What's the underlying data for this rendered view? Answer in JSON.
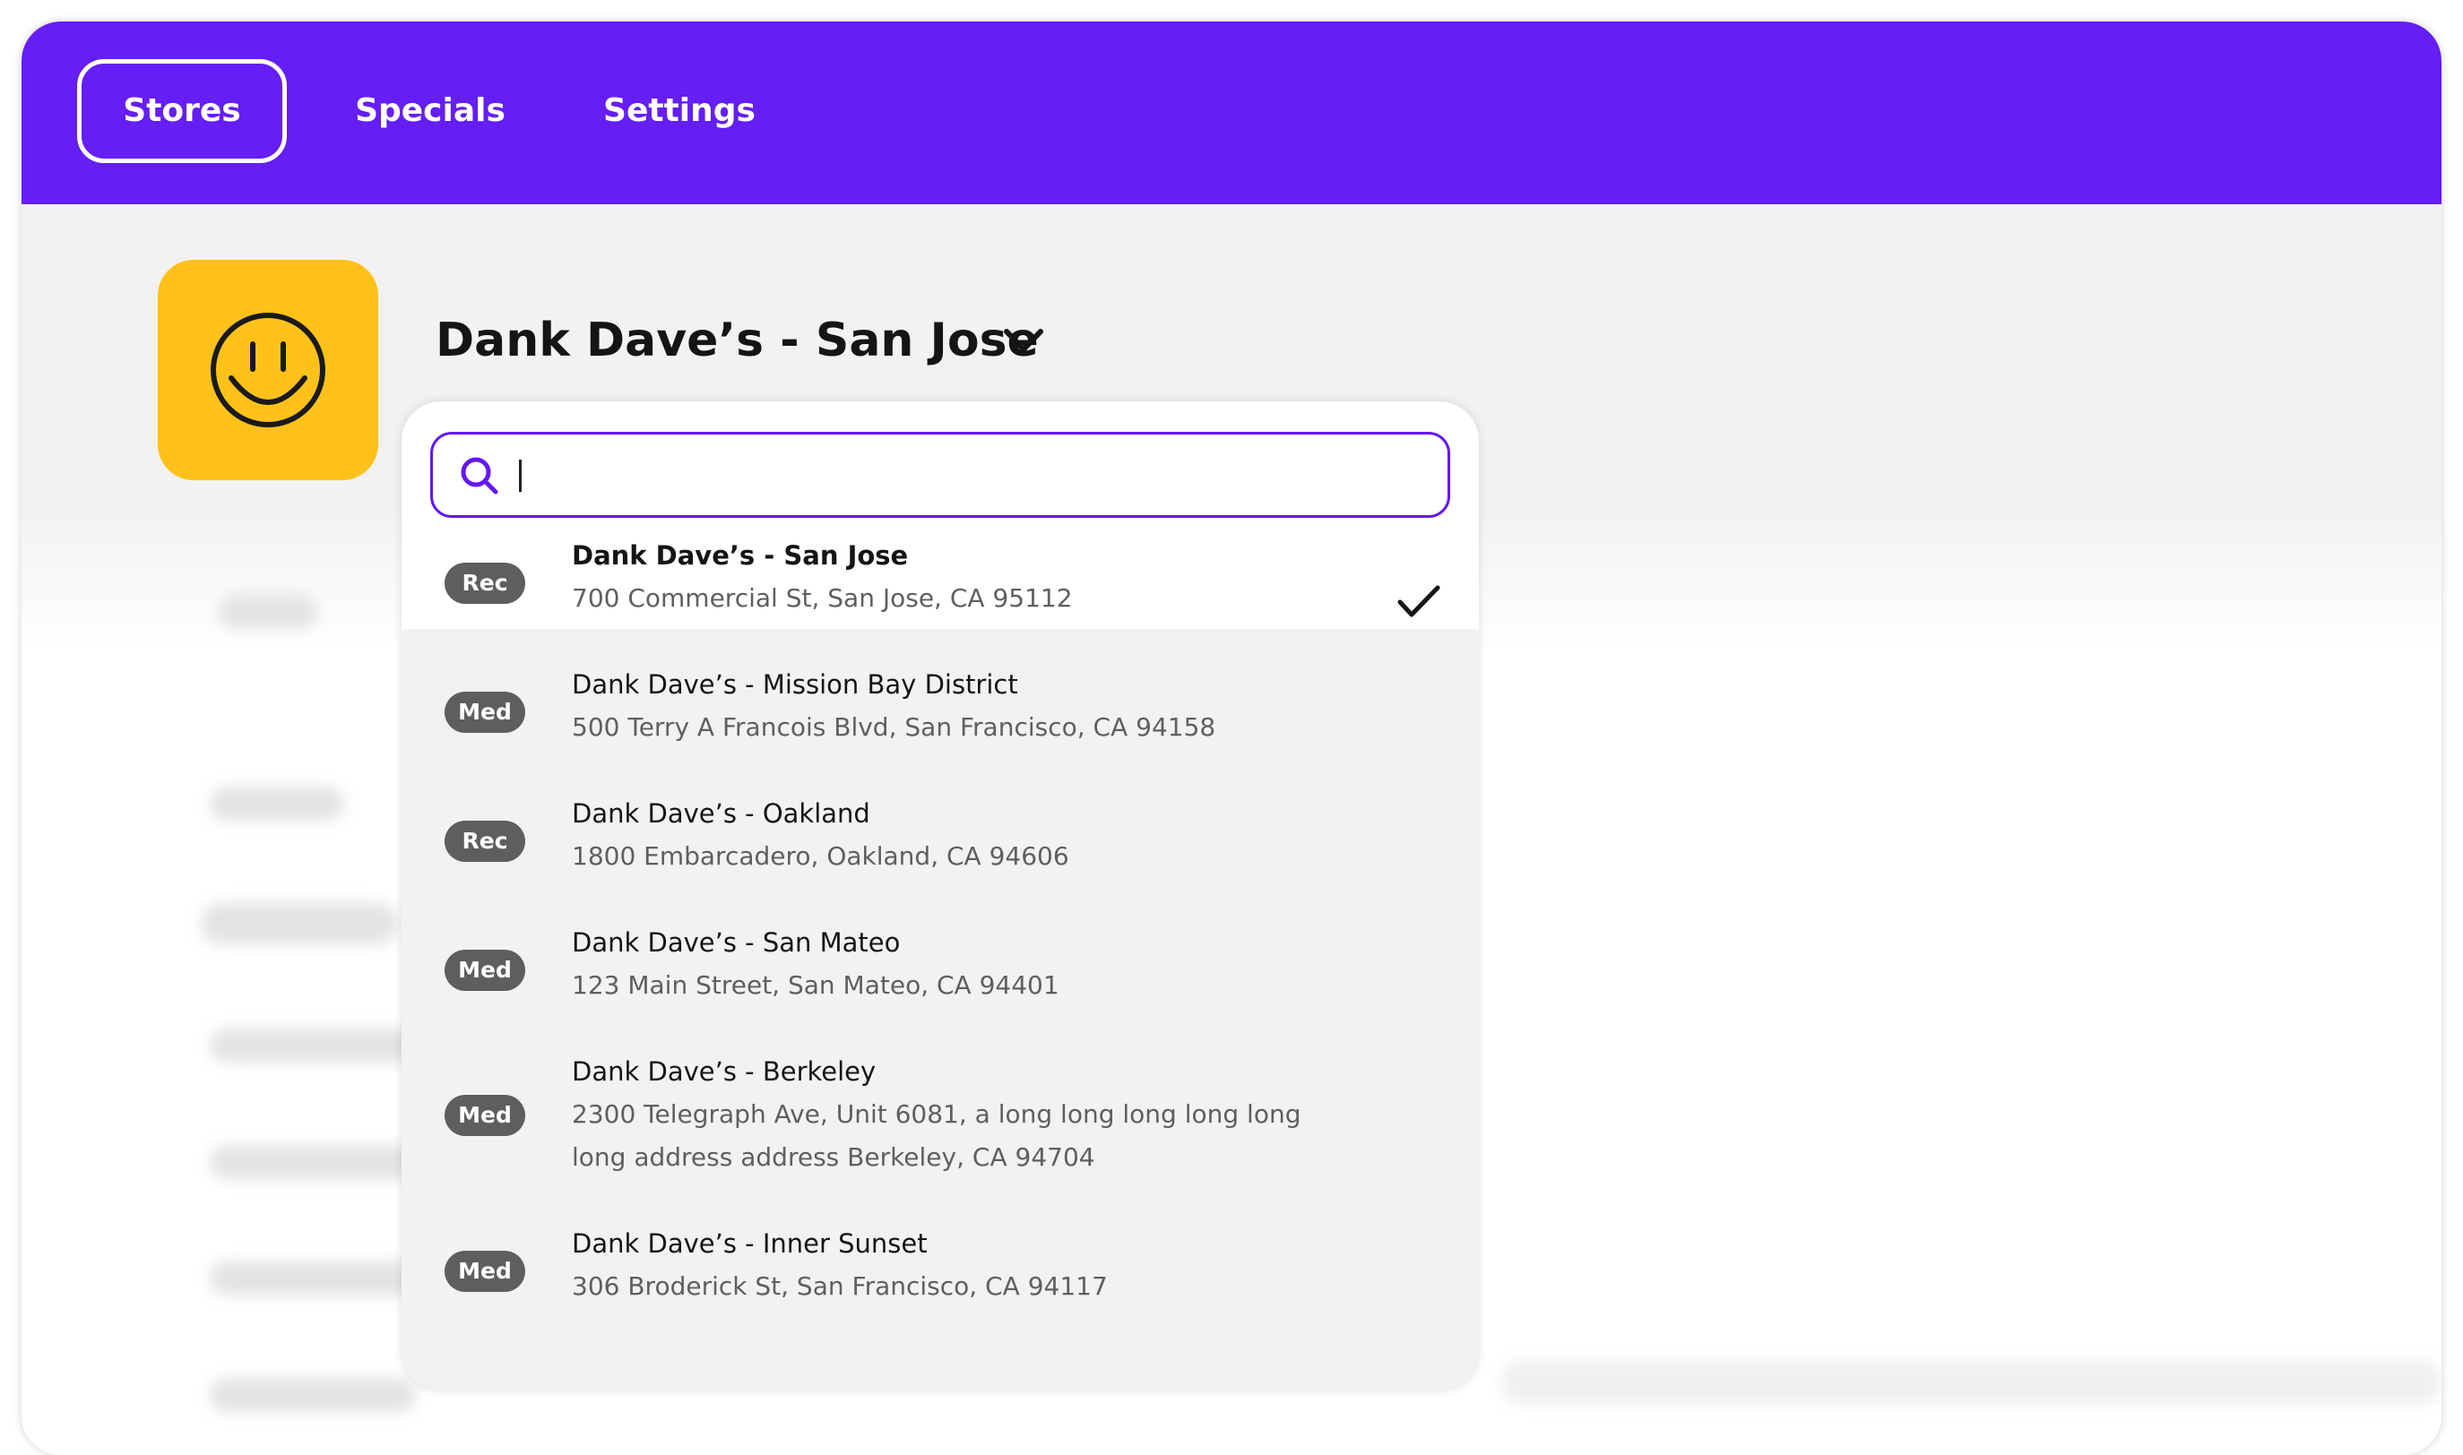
{
  "colors": {
    "brand": "#651ef3",
    "logo_bg": "#ffc21a",
    "badge_bg": "#5e5e5e"
  },
  "nav": {
    "tabs": [
      {
        "label": "Stores",
        "active": true
      },
      {
        "label": "Specials",
        "active": false
      },
      {
        "label": "Settings",
        "active": false
      }
    ]
  },
  "header": {
    "logo_icon": "smiley-face-icon",
    "store_title": "Dank Dave’s - San Jose",
    "dropdown_icon": "chevron-down-icon"
  },
  "dropdown": {
    "search": {
      "value": "",
      "placeholder": "",
      "icon": "search-icon"
    },
    "stores": [
      {
        "type": "Rec",
        "name": "Dank Dave’s - San Jose",
        "address": "700 Commercial St, San Jose, CA 95112",
        "selected": true
      },
      {
        "type": "Med",
        "name": "Dank Dave’s - Mission Bay District",
        "address": "500 Terry A Francois Blvd, San Francisco, CA 94158",
        "selected": false
      },
      {
        "type": "Rec",
        "name": "Dank Dave’s - Oakland",
        "address": "1800 Embarcadero, Oakland, CA 94606",
        "selected": false
      },
      {
        "type": "Med",
        "name": "Dank Dave’s - San Mateo",
        "address": "123 Main Street, San Mateo, CA 94401",
        "selected": false
      },
      {
        "type": "Med",
        "name": "Dank Dave’s - Berkeley",
        "address": "2300 Telegraph Ave, Unit 6081, a long long long long long long address address Berkeley, CA 94704",
        "selected": false
      },
      {
        "type": "Med",
        "name": "Dank Dave’s - Inner Sunset",
        "address": "306 Broderick St, San Francisco, CA 94117",
        "selected": false
      }
    ],
    "selected_icon": "checkmark-icon"
  }
}
